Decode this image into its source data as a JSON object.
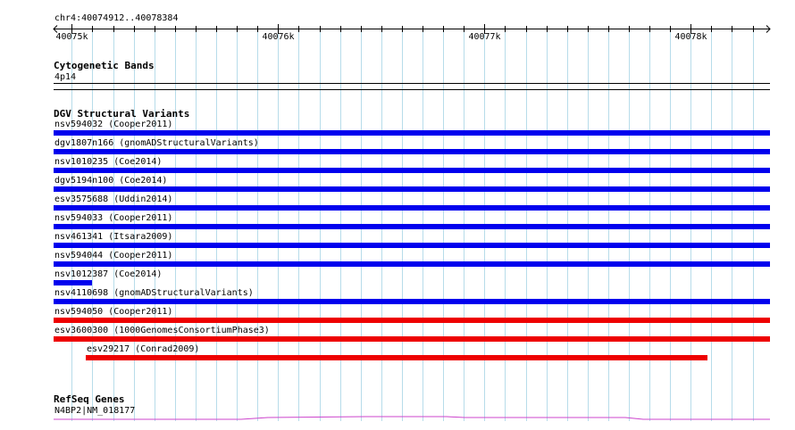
{
  "view": {
    "location_label": "chr4:40074912..40078384",
    "start": 40074912,
    "end": 40078384
  },
  "ruler": {
    "ticks": [
      {
        "pos": 40075000,
        "label": "40075k"
      },
      {
        "pos": 40076000,
        "label": "40076k"
      },
      {
        "pos": 40077000,
        "label": "40077k"
      },
      {
        "pos": 40078000,
        "label": "40078k"
      }
    ]
  },
  "colors": {
    "grid": "#b7dcea",
    "dgv_loss": "#0000ee",
    "dgv_gain": "#ee0000",
    "refseq": "#cc44cc"
  },
  "tracks": {
    "cytoband": {
      "title": "Cytogenetic Bands",
      "band_label": "4p14"
    },
    "dgv": {
      "title": "DGV Structural Variants",
      "variants": [
        {
          "label": "nsv594032 (Cooper2011)",
          "start": 40074912,
          "end": 40078384,
          "type": "loss"
        },
        {
          "label": "dgv1807n166 (gnomADStructuralVariants)",
          "start": 40074912,
          "end": 40078384,
          "type": "loss"
        },
        {
          "label": "nsv1010235 (Coe2014)",
          "start": 40074912,
          "end": 40078384,
          "type": "loss"
        },
        {
          "label": "dgv5194n100 (Coe2014)",
          "start": 40074912,
          "end": 40078384,
          "type": "loss"
        },
        {
          "label": "esv3575688 (Uddin2014)",
          "start": 40074912,
          "end": 40078384,
          "type": "loss"
        },
        {
          "label": "nsv594033 (Cooper2011)",
          "start": 40074912,
          "end": 40078384,
          "type": "loss"
        },
        {
          "label": "nsv461341 (Itsara2009)",
          "start": 40074912,
          "end": 40078384,
          "type": "loss"
        },
        {
          "label": "nsv594044 (Cooper2011)",
          "start": 40074912,
          "end": 40078384,
          "type": "loss"
        },
        {
          "label": "nsv1012387 (Coe2014)",
          "start": 40074912,
          "end": 40075100,
          "type": "loss"
        },
        {
          "label": "nsv4110698 (gnomADStructuralVariants)",
          "start": 40074912,
          "end": 40078384,
          "type": "loss"
        },
        {
          "label": "nsv594050 (Cooper2011)",
          "start": 40074912,
          "end": 40078384,
          "type": "gain"
        },
        {
          "label": "esv3600300 (1000GenomesConsortiumPhase3)",
          "start": 40074912,
          "end": 40078384,
          "type": "gain"
        },
        {
          "label": "esv29217 (Conrad2009)",
          "start": 40075070,
          "end": 40078085,
          "type": "gain"
        }
      ]
    },
    "refseq": {
      "title": "RefSeq Genes",
      "gene_label": "N4BP2|NM_018177"
    }
  }
}
